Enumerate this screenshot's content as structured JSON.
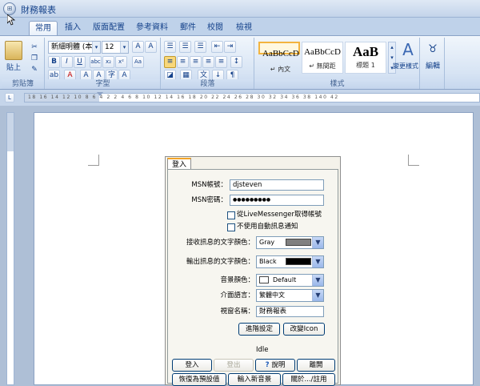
{
  "window": {
    "title": "財務報表"
  },
  "tabs": [
    "常用",
    "插入",
    "版面配置",
    "參考資料",
    "郵件",
    "校閱",
    "檢視"
  ],
  "ribbon": {
    "clipboard": {
      "label": "剪貼簿",
      "paste_label": "貼上"
    },
    "font": {
      "label": "字型",
      "font_name": "新細明體 (本文",
      "font_size": "12"
    },
    "paragraph": {
      "label": "段落"
    },
    "styles": {
      "label": "樣式",
      "items": [
        {
          "sample": "AaBbCcD",
          "name": "↵ 內文"
        },
        {
          "sample": "AaBbCcD",
          "name": "↵ 無間距"
        },
        {
          "sample": "AaB",
          "name": "標題 1"
        }
      ],
      "change_styles_label": "變更樣式"
    },
    "editing": {
      "label": "編輯"
    }
  },
  "ruler_numbers": "18 16 14 12 10 8 6 4 2 2 4 6 8 10 12 14 16 18 20 22 24 26 28 30 32 34 36 38 140 42",
  "dialog": {
    "tab_label": "登入",
    "msn_account_label": "MSN帳號：",
    "msn_account_value": "djsteven",
    "msn_password_label": "MSN密碼：",
    "msn_password_value": "●●●●●●●●●",
    "check_get_account": "從LiveMessenger取得帳號",
    "check_no_auto_notify": "不使用自動訊息通知",
    "recv_color_label": "接收訊息的文字顏色：",
    "recv_color_value": "Gray",
    "recv_color_hex": "#808080",
    "send_color_label": "輸出訊息的文字顏色：",
    "send_color_value": "Black",
    "send_color_hex": "#000000",
    "sound_color_label": "音景顏色：",
    "sound_color_value": "Default",
    "ui_lang_label": "介面語言：",
    "ui_lang_value": "繁體中文",
    "window_name_label": "視窗名稱：",
    "window_name_value": "財務報表",
    "advanced_button": "進階設定",
    "change_icon_button": "改變Icon",
    "status_text": "Idle",
    "login_button": "登入",
    "logout_button": "登出",
    "help_button": "說明",
    "exit_button": "離開",
    "restore_defaults_button": "恢復為預設值",
    "new_sound_button": "輸入新音景",
    "about_button": "關於.../註用"
  }
}
